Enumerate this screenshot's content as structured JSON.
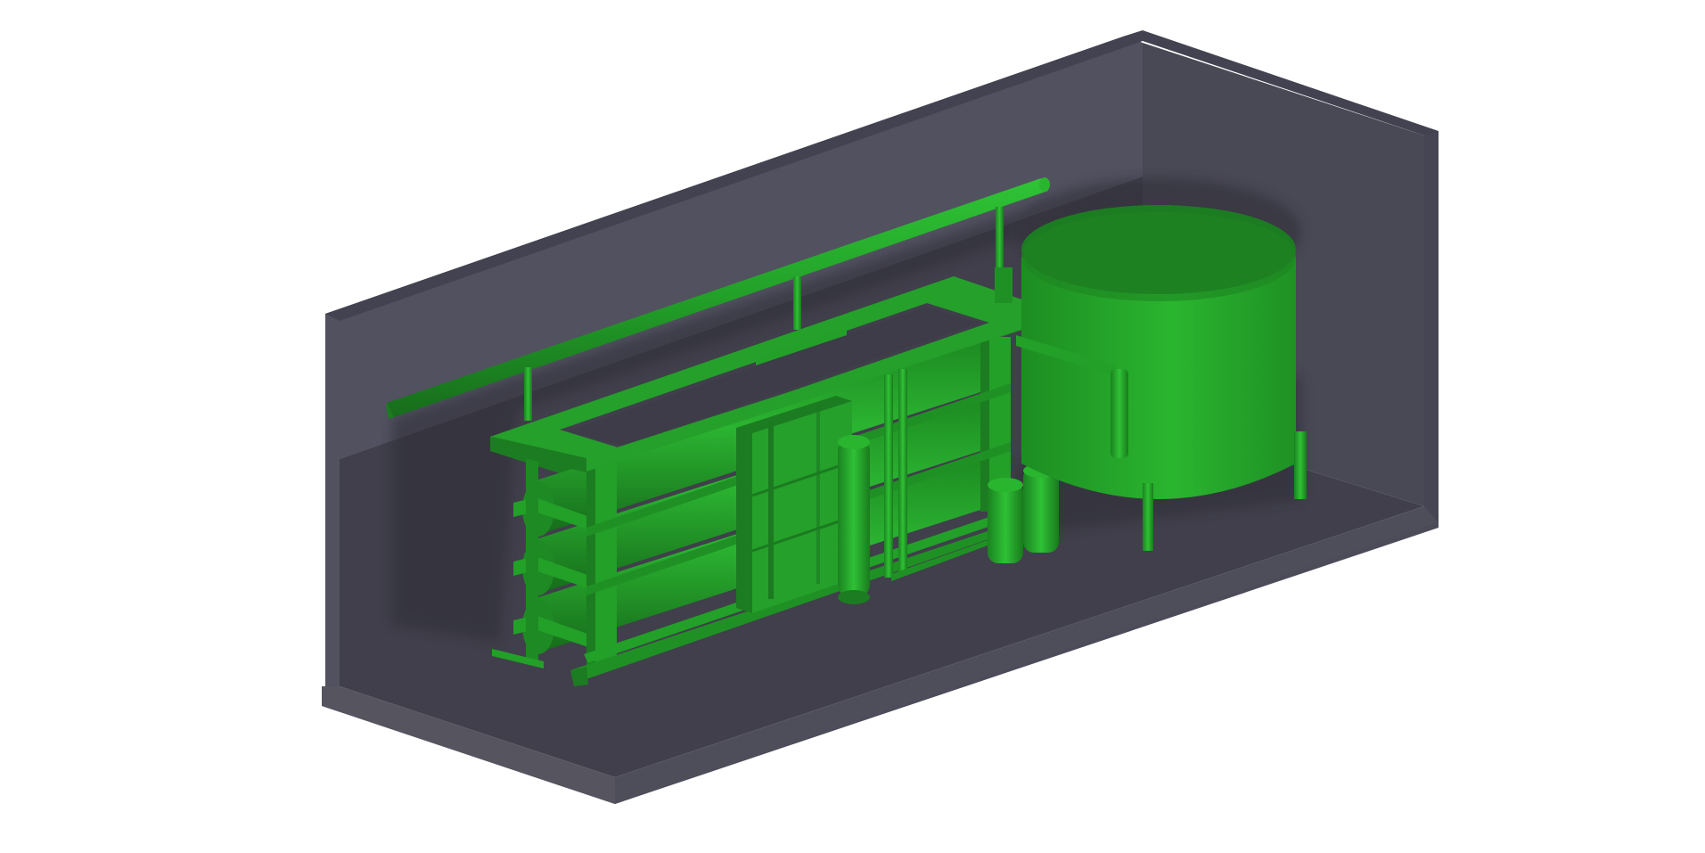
{
  "scene": {
    "colors": {
      "background": "#ffffff",
      "container_wall": "#52515f",
      "container_wall_dark": "#494855",
      "container_floor": "#403f4b",
      "container_rim": "#4a4955",
      "equipment_green": "#25a02b",
      "equipment_green_light": "#2ab52f",
      "equipment_green_dark": "#1c7c21",
      "shadow": "#2e2d37"
    },
    "objects": [
      "shipping-container",
      "ro-membrane-skid",
      "pressure-vessels",
      "skid-frame",
      "overhead-pipe",
      "control-panel",
      "cartridge-filter",
      "dosing-tanks",
      "storage-tank",
      "tank-legs"
    ]
  }
}
